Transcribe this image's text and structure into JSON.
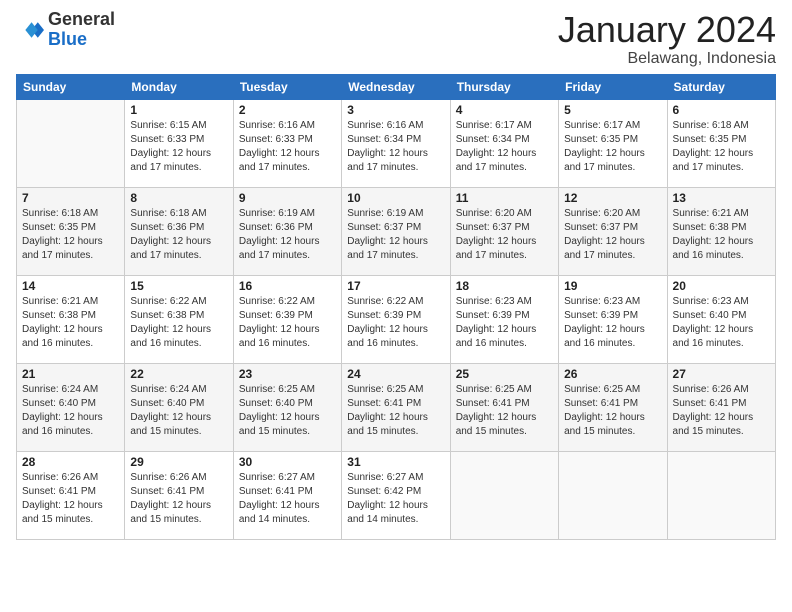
{
  "header": {
    "logo_general": "General",
    "logo_blue": "Blue",
    "month_title": "January 2024",
    "location": "Belawang, Indonesia"
  },
  "weekdays": [
    "Sunday",
    "Monday",
    "Tuesday",
    "Wednesday",
    "Thursday",
    "Friday",
    "Saturday"
  ],
  "weeks": [
    [
      {
        "day": "",
        "info": ""
      },
      {
        "day": "1",
        "info": "Sunrise: 6:15 AM\nSunset: 6:33 PM\nDaylight: 12 hours\nand 17 minutes."
      },
      {
        "day": "2",
        "info": "Sunrise: 6:16 AM\nSunset: 6:33 PM\nDaylight: 12 hours\nand 17 minutes."
      },
      {
        "day": "3",
        "info": "Sunrise: 6:16 AM\nSunset: 6:34 PM\nDaylight: 12 hours\nand 17 minutes."
      },
      {
        "day": "4",
        "info": "Sunrise: 6:17 AM\nSunset: 6:34 PM\nDaylight: 12 hours\nand 17 minutes."
      },
      {
        "day": "5",
        "info": "Sunrise: 6:17 AM\nSunset: 6:35 PM\nDaylight: 12 hours\nand 17 minutes."
      },
      {
        "day": "6",
        "info": "Sunrise: 6:18 AM\nSunset: 6:35 PM\nDaylight: 12 hours\nand 17 minutes."
      }
    ],
    [
      {
        "day": "7",
        "info": "Sunrise: 6:18 AM\nSunset: 6:35 PM\nDaylight: 12 hours\nand 17 minutes."
      },
      {
        "day": "8",
        "info": "Sunrise: 6:18 AM\nSunset: 6:36 PM\nDaylight: 12 hours\nand 17 minutes."
      },
      {
        "day": "9",
        "info": "Sunrise: 6:19 AM\nSunset: 6:36 PM\nDaylight: 12 hours\nand 17 minutes."
      },
      {
        "day": "10",
        "info": "Sunrise: 6:19 AM\nSunset: 6:37 PM\nDaylight: 12 hours\nand 17 minutes."
      },
      {
        "day": "11",
        "info": "Sunrise: 6:20 AM\nSunset: 6:37 PM\nDaylight: 12 hours\nand 17 minutes."
      },
      {
        "day": "12",
        "info": "Sunrise: 6:20 AM\nSunset: 6:37 PM\nDaylight: 12 hours\nand 17 minutes."
      },
      {
        "day": "13",
        "info": "Sunrise: 6:21 AM\nSunset: 6:38 PM\nDaylight: 12 hours\nand 16 minutes."
      }
    ],
    [
      {
        "day": "14",
        "info": "Sunrise: 6:21 AM\nSunset: 6:38 PM\nDaylight: 12 hours\nand 16 minutes."
      },
      {
        "day": "15",
        "info": "Sunrise: 6:22 AM\nSunset: 6:38 PM\nDaylight: 12 hours\nand 16 minutes."
      },
      {
        "day": "16",
        "info": "Sunrise: 6:22 AM\nSunset: 6:39 PM\nDaylight: 12 hours\nand 16 minutes."
      },
      {
        "day": "17",
        "info": "Sunrise: 6:22 AM\nSunset: 6:39 PM\nDaylight: 12 hours\nand 16 minutes."
      },
      {
        "day": "18",
        "info": "Sunrise: 6:23 AM\nSunset: 6:39 PM\nDaylight: 12 hours\nand 16 minutes."
      },
      {
        "day": "19",
        "info": "Sunrise: 6:23 AM\nSunset: 6:39 PM\nDaylight: 12 hours\nand 16 minutes."
      },
      {
        "day": "20",
        "info": "Sunrise: 6:23 AM\nSunset: 6:40 PM\nDaylight: 12 hours\nand 16 minutes."
      }
    ],
    [
      {
        "day": "21",
        "info": "Sunrise: 6:24 AM\nSunset: 6:40 PM\nDaylight: 12 hours\nand 16 minutes."
      },
      {
        "day": "22",
        "info": "Sunrise: 6:24 AM\nSunset: 6:40 PM\nDaylight: 12 hours\nand 15 minutes."
      },
      {
        "day": "23",
        "info": "Sunrise: 6:25 AM\nSunset: 6:40 PM\nDaylight: 12 hours\nand 15 minutes."
      },
      {
        "day": "24",
        "info": "Sunrise: 6:25 AM\nSunset: 6:41 PM\nDaylight: 12 hours\nand 15 minutes."
      },
      {
        "day": "25",
        "info": "Sunrise: 6:25 AM\nSunset: 6:41 PM\nDaylight: 12 hours\nand 15 minutes."
      },
      {
        "day": "26",
        "info": "Sunrise: 6:25 AM\nSunset: 6:41 PM\nDaylight: 12 hours\nand 15 minutes."
      },
      {
        "day": "27",
        "info": "Sunrise: 6:26 AM\nSunset: 6:41 PM\nDaylight: 12 hours\nand 15 minutes."
      }
    ],
    [
      {
        "day": "28",
        "info": "Sunrise: 6:26 AM\nSunset: 6:41 PM\nDaylight: 12 hours\nand 15 minutes."
      },
      {
        "day": "29",
        "info": "Sunrise: 6:26 AM\nSunset: 6:41 PM\nDaylight: 12 hours\nand 15 minutes."
      },
      {
        "day": "30",
        "info": "Sunrise: 6:27 AM\nSunset: 6:41 PM\nDaylight: 12 hours\nand 14 minutes."
      },
      {
        "day": "31",
        "info": "Sunrise: 6:27 AM\nSunset: 6:42 PM\nDaylight: 12 hours\nand 14 minutes."
      },
      {
        "day": "",
        "info": ""
      },
      {
        "day": "",
        "info": ""
      },
      {
        "day": "",
        "info": ""
      }
    ]
  ]
}
